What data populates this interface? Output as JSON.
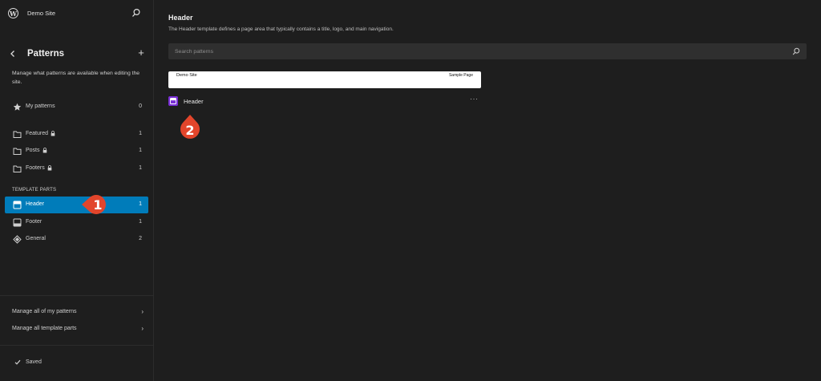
{
  "site": {
    "name": "Demo Site"
  },
  "nav": {
    "title": "Patterns",
    "description": "Manage what patterns are available when editing the site.",
    "my_patterns": {
      "label": "My patterns",
      "count": "0"
    },
    "categories": [
      {
        "label": "Featured",
        "count": "1"
      },
      {
        "label": "Posts",
        "count": "1"
      },
      {
        "label": "Footers",
        "count": "1"
      }
    ],
    "template_parts_heading": "TEMPLATE PARTS",
    "template_parts": [
      {
        "label": "Header",
        "count": "1"
      },
      {
        "label": "Footer",
        "count": "1"
      },
      {
        "label": "General",
        "count": "2"
      }
    ],
    "footer_links": [
      {
        "label": "Manage all of my patterns"
      },
      {
        "label": "Manage all template parts"
      }
    ],
    "saved_label": "Saved"
  },
  "main": {
    "title": "Header",
    "description": "The Header template defines a page area that typically contains a title, logo, and main navigation.",
    "search_placeholder": "Search patterns",
    "preview": {
      "site_title": "Demo Site",
      "nav_link": "Sample Page"
    },
    "pattern_name": "Header"
  },
  "callouts": [
    {
      "number": "1"
    },
    {
      "number": "2"
    }
  ],
  "colors": {
    "accent": "#007cba",
    "callout": "#e2452b",
    "pattern_icon": "#7a2fd6"
  }
}
